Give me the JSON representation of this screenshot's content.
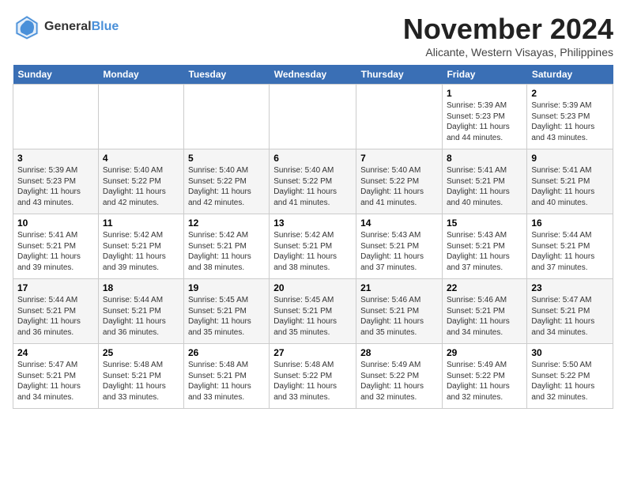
{
  "logo": {
    "line1": "General",
    "line2": "Blue"
  },
  "title": "November 2024",
  "location": "Alicante, Western Visayas, Philippines",
  "days_of_week": [
    "Sunday",
    "Monday",
    "Tuesday",
    "Wednesday",
    "Thursday",
    "Friday",
    "Saturday"
  ],
  "weeks": [
    [
      {
        "day": "",
        "info": ""
      },
      {
        "day": "",
        "info": ""
      },
      {
        "day": "",
        "info": ""
      },
      {
        "day": "",
        "info": ""
      },
      {
        "day": "",
        "info": ""
      },
      {
        "day": "1",
        "info": "Sunrise: 5:39 AM\nSunset: 5:23 PM\nDaylight: 11 hours and 44 minutes."
      },
      {
        "day": "2",
        "info": "Sunrise: 5:39 AM\nSunset: 5:23 PM\nDaylight: 11 hours and 43 minutes."
      }
    ],
    [
      {
        "day": "3",
        "info": "Sunrise: 5:39 AM\nSunset: 5:23 PM\nDaylight: 11 hours and 43 minutes."
      },
      {
        "day": "4",
        "info": "Sunrise: 5:40 AM\nSunset: 5:22 PM\nDaylight: 11 hours and 42 minutes."
      },
      {
        "day": "5",
        "info": "Sunrise: 5:40 AM\nSunset: 5:22 PM\nDaylight: 11 hours and 42 minutes."
      },
      {
        "day": "6",
        "info": "Sunrise: 5:40 AM\nSunset: 5:22 PM\nDaylight: 11 hours and 41 minutes."
      },
      {
        "day": "7",
        "info": "Sunrise: 5:40 AM\nSunset: 5:22 PM\nDaylight: 11 hours and 41 minutes."
      },
      {
        "day": "8",
        "info": "Sunrise: 5:41 AM\nSunset: 5:21 PM\nDaylight: 11 hours and 40 minutes."
      },
      {
        "day": "9",
        "info": "Sunrise: 5:41 AM\nSunset: 5:21 PM\nDaylight: 11 hours and 40 minutes."
      }
    ],
    [
      {
        "day": "10",
        "info": "Sunrise: 5:41 AM\nSunset: 5:21 PM\nDaylight: 11 hours and 39 minutes."
      },
      {
        "day": "11",
        "info": "Sunrise: 5:42 AM\nSunset: 5:21 PM\nDaylight: 11 hours and 39 minutes."
      },
      {
        "day": "12",
        "info": "Sunrise: 5:42 AM\nSunset: 5:21 PM\nDaylight: 11 hours and 38 minutes."
      },
      {
        "day": "13",
        "info": "Sunrise: 5:42 AM\nSunset: 5:21 PM\nDaylight: 11 hours and 38 minutes."
      },
      {
        "day": "14",
        "info": "Sunrise: 5:43 AM\nSunset: 5:21 PM\nDaylight: 11 hours and 37 minutes."
      },
      {
        "day": "15",
        "info": "Sunrise: 5:43 AM\nSunset: 5:21 PM\nDaylight: 11 hours and 37 minutes."
      },
      {
        "day": "16",
        "info": "Sunrise: 5:44 AM\nSunset: 5:21 PM\nDaylight: 11 hours and 37 minutes."
      }
    ],
    [
      {
        "day": "17",
        "info": "Sunrise: 5:44 AM\nSunset: 5:21 PM\nDaylight: 11 hours and 36 minutes."
      },
      {
        "day": "18",
        "info": "Sunrise: 5:44 AM\nSunset: 5:21 PM\nDaylight: 11 hours and 36 minutes."
      },
      {
        "day": "19",
        "info": "Sunrise: 5:45 AM\nSunset: 5:21 PM\nDaylight: 11 hours and 35 minutes."
      },
      {
        "day": "20",
        "info": "Sunrise: 5:45 AM\nSunset: 5:21 PM\nDaylight: 11 hours and 35 minutes."
      },
      {
        "day": "21",
        "info": "Sunrise: 5:46 AM\nSunset: 5:21 PM\nDaylight: 11 hours and 35 minutes."
      },
      {
        "day": "22",
        "info": "Sunrise: 5:46 AM\nSunset: 5:21 PM\nDaylight: 11 hours and 34 minutes."
      },
      {
        "day": "23",
        "info": "Sunrise: 5:47 AM\nSunset: 5:21 PM\nDaylight: 11 hours and 34 minutes."
      }
    ],
    [
      {
        "day": "24",
        "info": "Sunrise: 5:47 AM\nSunset: 5:21 PM\nDaylight: 11 hours and 34 minutes."
      },
      {
        "day": "25",
        "info": "Sunrise: 5:48 AM\nSunset: 5:21 PM\nDaylight: 11 hours and 33 minutes."
      },
      {
        "day": "26",
        "info": "Sunrise: 5:48 AM\nSunset: 5:21 PM\nDaylight: 11 hours and 33 minutes."
      },
      {
        "day": "27",
        "info": "Sunrise: 5:48 AM\nSunset: 5:22 PM\nDaylight: 11 hours and 33 minutes."
      },
      {
        "day": "28",
        "info": "Sunrise: 5:49 AM\nSunset: 5:22 PM\nDaylight: 11 hours and 32 minutes."
      },
      {
        "day": "29",
        "info": "Sunrise: 5:49 AM\nSunset: 5:22 PM\nDaylight: 11 hours and 32 minutes."
      },
      {
        "day": "30",
        "info": "Sunrise: 5:50 AM\nSunset: 5:22 PM\nDaylight: 11 hours and 32 minutes."
      }
    ]
  ]
}
